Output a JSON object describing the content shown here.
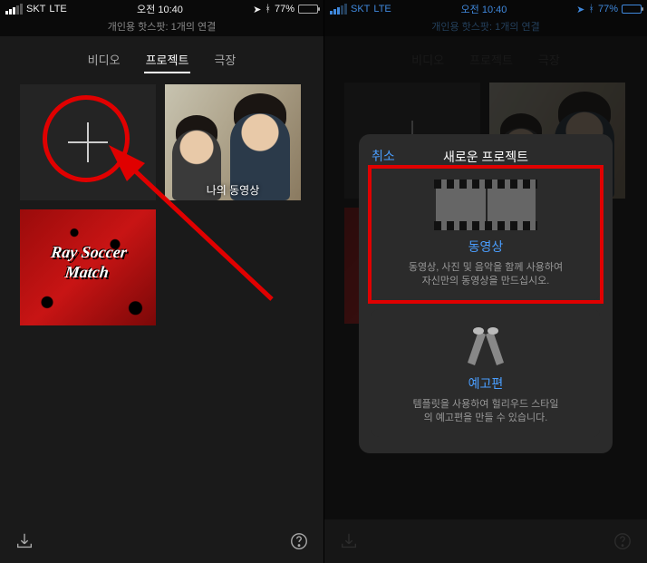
{
  "statusbar": {
    "carrier": "SKT",
    "network": "LTE",
    "time": "오전 10:40",
    "battery_pct": "77%"
  },
  "subtitle": "개인용 핫스팟: 1개의 연결",
  "tabs": {
    "video": "비디오",
    "project": "프로젝트",
    "theater": "극장"
  },
  "tiles": {
    "my_video_caption": "나의 동영상",
    "poster_text": "Ray Soccer\nMatch"
  },
  "modal": {
    "cancel": "취소",
    "title": "새로운 프로젝트",
    "movie": {
      "title": "동영상",
      "desc": "동영상, 사진 및 음악을 함께 사용하여\n자신만의 동영상을 만드십시오."
    },
    "trailer": {
      "title": "예고편",
      "desc": "템플릿을 사용하여 헐리우드 스타일\n의 예고편을 만들 수 있습니다."
    }
  }
}
